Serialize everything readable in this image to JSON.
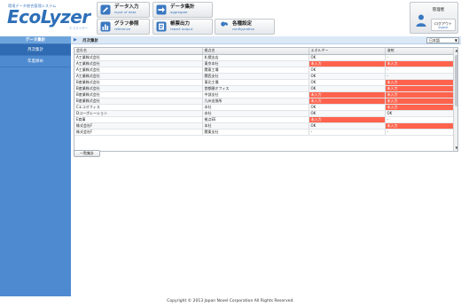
{
  "brand": {
    "subtitle": "環境データ統合管理システム",
    "name": "EcoLyzer",
    "kana": "エコライザー"
  },
  "nav": [
    {
      "label": "データ入力",
      "sub": "input of data",
      "icon": "pencil-icon"
    },
    {
      "label": "データ集計",
      "sub": "aggregate",
      "icon": "arrow-icon"
    },
    {
      "label": "グラフ参照",
      "sub": "reference",
      "icon": "bar-chart-icon"
    },
    {
      "label": "帳票出力",
      "sub": "report output",
      "icon": "report-icon"
    },
    {
      "label": "各種設定",
      "sub": "configuration",
      "icon": "wrench-icon"
    }
  ],
  "user": {
    "role": "管理者",
    "logout_label": "ログアウト",
    "logout_sub": "logout"
  },
  "sidebar": {
    "header": "データ集計",
    "items": [
      "月次集計",
      "年度締め"
    ]
  },
  "breadcrumb": "月次集計",
  "language": "日本語",
  "table": {
    "columns": [
      "会社名",
      "拠点名",
      "エネルギー",
      "溶剤"
    ],
    "rows": [
      [
        "A工業株式会社",
        "札幌支店",
        "OK",
        "-"
      ],
      [
        "A工業株式会社",
        "東京本社",
        "未入力",
        "未入力"
      ],
      [
        "A工業株式会社",
        "関東工場",
        "OK",
        "-"
      ],
      [
        "A工業株式会社",
        "関西支社",
        "OK",
        "-"
      ],
      [
        "B産業株式会社",
        "東北工場",
        "OK",
        "未入力"
      ],
      [
        "B産業株式会社",
        "首都圏オフィス",
        "OK",
        "未入力"
      ],
      [
        "B産業株式会社",
        "中部支社",
        "未入力",
        "未入力"
      ],
      [
        "B産業株式会社",
        "九州出張所",
        "未入力",
        "未入力"
      ],
      [
        "Cエコオフィス",
        "本社",
        "OK",
        "未入力"
      ],
      [
        "Dコーポレーション",
        "本社",
        "OK",
        "OK"
      ],
      [
        "E商事",
        "拠点EE",
        "未入力",
        "-"
      ],
      [
        "株式会社F",
        "本社",
        "OK",
        "未入力"
      ],
      [
        "株式会社F",
        "関東支社",
        "-",
        "-"
      ]
    ]
  },
  "list_button": "一覧集計",
  "footer": "Copyright © 2013 Japan Novel Corporation All Rights Reserved.",
  "colors": {
    "accent": "#2e6fb8",
    "sidebar": "#4e8ad0",
    "warning": "#ff634d"
  }
}
